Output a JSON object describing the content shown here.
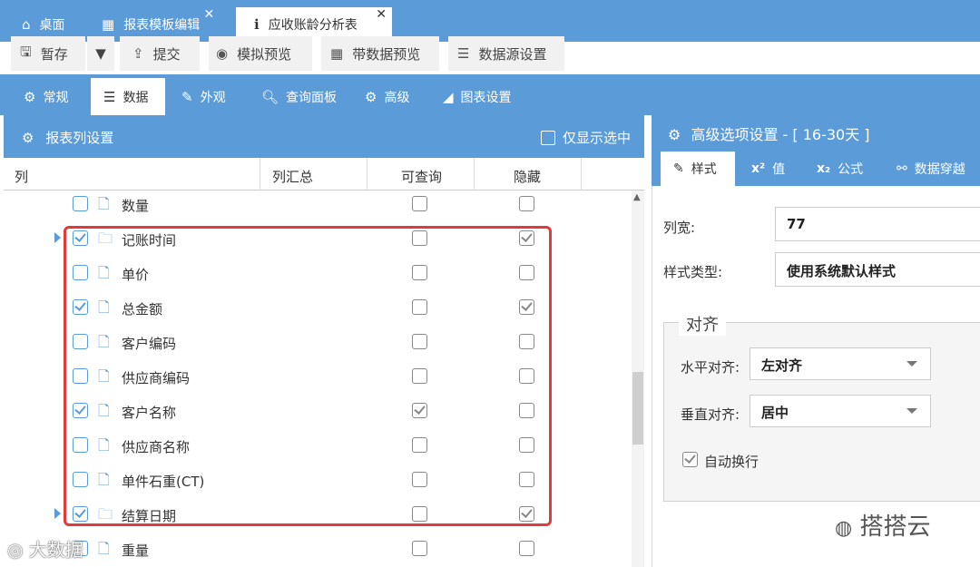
{
  "tabs": [
    {
      "icon": "⌂",
      "label": "桌面"
    },
    {
      "icon": "▦",
      "label": "报表模板编辑"
    },
    {
      "icon": "ℹ",
      "label": "应收账龄分析表"
    }
  ],
  "toolbar": {
    "save": "暂存",
    "submit": "提交",
    "sim_preview": "模拟预览",
    "data_preview": "带数据预览",
    "datasource": "数据源设置"
  },
  "config_tabs": [
    "常规",
    "数据",
    "外观",
    "查询面板",
    "高级",
    "图表设置"
  ],
  "left_panel": {
    "title": "报表列设置",
    "only_selected": "仅显示选中",
    "headers": {
      "col": "列",
      "summary": "列汇总",
      "query": "可查询",
      "hidden": "隐藏"
    }
  },
  "rows": [
    {
      "label": "数量",
      "checked": false,
      "type": "file",
      "expand": false,
      "query": false,
      "hidden": false
    },
    {
      "label": "记账时间",
      "checked": true,
      "type": "folder",
      "expand": true,
      "query": false,
      "hidden": true
    },
    {
      "label": "单价",
      "checked": false,
      "type": "file",
      "expand": false,
      "query": false,
      "hidden": false
    },
    {
      "label": "总金额",
      "checked": true,
      "type": "file",
      "expand": false,
      "query": false,
      "hidden": true
    },
    {
      "label": "客户编码",
      "checked": false,
      "type": "file",
      "expand": false,
      "query": false,
      "hidden": false
    },
    {
      "label": "供应商编码",
      "checked": false,
      "type": "file",
      "expand": false,
      "query": false,
      "hidden": false
    },
    {
      "label": "客户名称",
      "checked": true,
      "type": "file",
      "expand": false,
      "query": true,
      "hidden": false
    },
    {
      "label": "供应商名称",
      "checked": false,
      "type": "file",
      "expand": false,
      "query": false,
      "hidden": false
    },
    {
      "label": "单件石重(CT)",
      "checked": false,
      "type": "file",
      "expand": false,
      "query": false,
      "hidden": false
    },
    {
      "label": "结算日期",
      "checked": true,
      "type": "folder",
      "expand": true,
      "query": false,
      "hidden": true
    },
    {
      "label": "重量",
      "checked": false,
      "type": "file",
      "expand": false,
      "query": false,
      "hidden": false
    }
  ],
  "right_panel": {
    "title": "高级选项设置 - [ 16-30天 ]",
    "tabs": [
      {
        "icon": "✎",
        "label": "样式"
      },
      {
        "icon": "x²",
        "label": "值"
      },
      {
        "icon": "x₂",
        "label": "公式"
      },
      {
        "icon": "⚯",
        "label": "数据穿越"
      }
    ],
    "width_label": "列宽:",
    "width_value": "77",
    "style_label": "样式类型:",
    "style_value": "使用系统默认样式",
    "align_legend": "对齐",
    "h_align_label": "水平对齐:",
    "h_align_value": "左对齐",
    "v_align_label": "垂直对齐:",
    "v_align_value": "居中",
    "wrap_label": "自动换行",
    "wrap_checked": true
  },
  "watermarks": {
    "left": "大数据",
    "right": "搭搭云"
  }
}
